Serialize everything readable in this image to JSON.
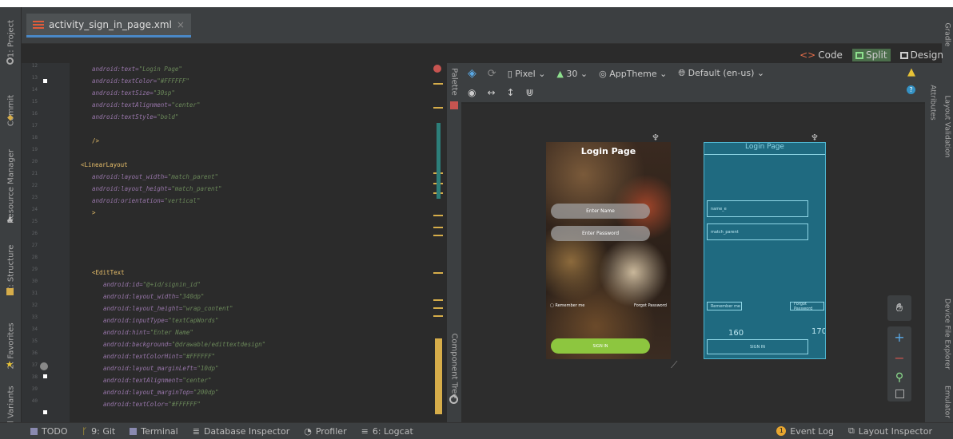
{
  "editor_tab": {
    "title": "activity_sign_in_page.xml",
    "close": "×"
  },
  "left_tools": [
    "1: Project",
    "Commit",
    "Resource Manager",
    "Z: Structure",
    "2: Favorites",
    "d Variants"
  ],
  "right_tools": [
    "Gradle",
    "Layout Validation",
    "Attributes",
    "Device File Explorer",
    "Emulator"
  ],
  "view_modes": {
    "code": "Code",
    "split": "Split",
    "design": "Design"
  },
  "palette_label": "Palette",
  "component_tree_label": "Component Tree",
  "design_toolbar": {
    "device": "Pixel",
    "api": "30",
    "theme": "AppTheme",
    "locale": "Default (en-us)"
  },
  "code_lines": [
    {
      "n": "12",
      "indent": 2,
      "parts": [
        [
          "attr",
          "android:text="
        ],
        [
          "val",
          "\"Login Page\""
        ]
      ]
    },
    {
      "n": "13",
      "indent": 2,
      "parts": [
        [
          "attr",
          "android:textColor="
        ],
        [
          "val",
          "\"#FFFFFF\""
        ]
      ]
    },
    {
      "n": "14",
      "indent": 2,
      "parts": [
        [
          "attr",
          "android:textSize="
        ],
        [
          "val",
          "\"30sp\""
        ]
      ]
    },
    {
      "n": "15",
      "indent": 2,
      "parts": [
        [
          "attr",
          "android:textAlignment="
        ],
        [
          "val",
          "\"center\""
        ]
      ]
    },
    {
      "n": "16",
      "indent": 2,
      "parts": [
        [
          "attr",
          "android:textStyle="
        ],
        [
          "val",
          "\"bold\""
        ]
      ]
    },
    {
      "n": "17",
      "indent": 0,
      "parts": []
    },
    {
      "n": "18",
      "indent": 2,
      "parts": [
        [
          "tag",
          "/>"
        ]
      ]
    },
    {
      "n": "19",
      "indent": 0,
      "parts": []
    },
    {
      "n": "20",
      "indent": 1,
      "parts": [
        [
          "tag",
          "<LinearLayout"
        ]
      ]
    },
    {
      "n": "21",
      "indent": 2,
      "parts": [
        [
          "attr",
          "android:layout_width="
        ],
        [
          "val",
          "\"match_parent\""
        ]
      ]
    },
    {
      "n": "22",
      "indent": 2,
      "parts": [
        [
          "attr",
          "android:layout_height="
        ],
        [
          "val",
          "\"match_parent\""
        ]
      ]
    },
    {
      "n": "23",
      "indent": 2,
      "parts": [
        [
          "attr",
          "android:orientation="
        ],
        [
          "val",
          "\"vertical\""
        ]
      ]
    },
    {
      "n": "24",
      "indent": 2,
      "parts": [
        [
          "tag",
          ">"
        ]
      ]
    },
    {
      "n": "25",
      "indent": 0,
      "parts": []
    },
    {
      "n": "26",
      "indent": 0,
      "parts": []
    },
    {
      "n": "27",
      "indent": 0,
      "parts": []
    },
    {
      "n": "28",
      "indent": 0,
      "parts": []
    },
    {
      "n": "29",
      "indent": 2,
      "parts": [
        [
          "tag",
          "<EditText"
        ]
      ]
    },
    {
      "n": "30",
      "indent": 3,
      "parts": [
        [
          "attr",
          "android:id="
        ],
        [
          "val",
          "\"@+id/signin_id\""
        ]
      ]
    },
    {
      "n": "31",
      "indent": 3,
      "parts": [
        [
          "attr",
          "android:layout_width="
        ],
        [
          "val",
          "\"340dp\""
        ]
      ]
    },
    {
      "n": "32",
      "indent": 3,
      "parts": [
        [
          "attr",
          "android:layout_height="
        ],
        [
          "val",
          "\"wrap_content\""
        ]
      ]
    },
    {
      "n": "33",
      "indent": 3,
      "parts": [
        [
          "attr",
          "android:inputType="
        ],
        [
          "val",
          "\"textCapWords\""
        ]
      ]
    },
    {
      "n": "34",
      "indent": 3,
      "parts": [
        [
          "attr",
          "android:hint="
        ],
        [
          "val",
          "\"Enter Name\""
        ]
      ]
    },
    {
      "n": "35",
      "indent": 3,
      "parts": [
        [
          "attr",
          "android:background="
        ],
        [
          "val",
          "\"@drawable/edittextdesign\""
        ]
      ]
    },
    {
      "n": "36",
      "indent": 3,
      "parts": [
        [
          "attr",
          "android:textColorHint="
        ],
        [
          "val",
          "\"#FFFFFF\""
        ]
      ]
    },
    {
      "n": "37",
      "indent": 3,
      "parts": [
        [
          "attr",
          "android:layout_marginLeft="
        ],
        [
          "val",
          "\"10dp\""
        ]
      ]
    },
    {
      "n": "38",
      "indent": 3,
      "parts": [
        [
          "attr",
          "android:textAlignment="
        ],
        [
          "val",
          "\"center\""
        ]
      ]
    },
    {
      "n": "39",
      "indent": 3,
      "parts": [
        [
          "attr",
          "android:layout_marginTop="
        ],
        [
          "val",
          "\"200dp\""
        ]
      ]
    },
    {
      "n": "40",
      "indent": 3,
      "parts": [
        [
          "attr",
          "android:textColor="
        ],
        [
          "val",
          "\"#FFFFFF\""
        ]
      ]
    }
  ],
  "preview": {
    "title": "Login Page",
    "name_hint": "Enter Name",
    "password_hint": "Enter Password",
    "remember": "Remember me",
    "forgot": "Forgot Password",
    "sign_in": "SIGN IN",
    "accent": "#8dc63f"
  },
  "blueprint": {
    "title": "Login Page",
    "name_box": "name_e",
    "password_box": "match_parent",
    "remember_box": "Remember me",
    "forgot_box": "Forgot Password",
    "dim_left": "160",
    "dim_right": "170",
    "sign_in_box": "SIGN IN"
  },
  "bottom_bar": {
    "todo": "TODO",
    "git": "9: Git",
    "terminal": "Terminal",
    "database": "Database Inspector",
    "profiler": "Profiler",
    "logcat": "6: Logcat",
    "event_log": "Event Log",
    "layout_inspector": "Layout Inspector",
    "event_count": "1"
  }
}
